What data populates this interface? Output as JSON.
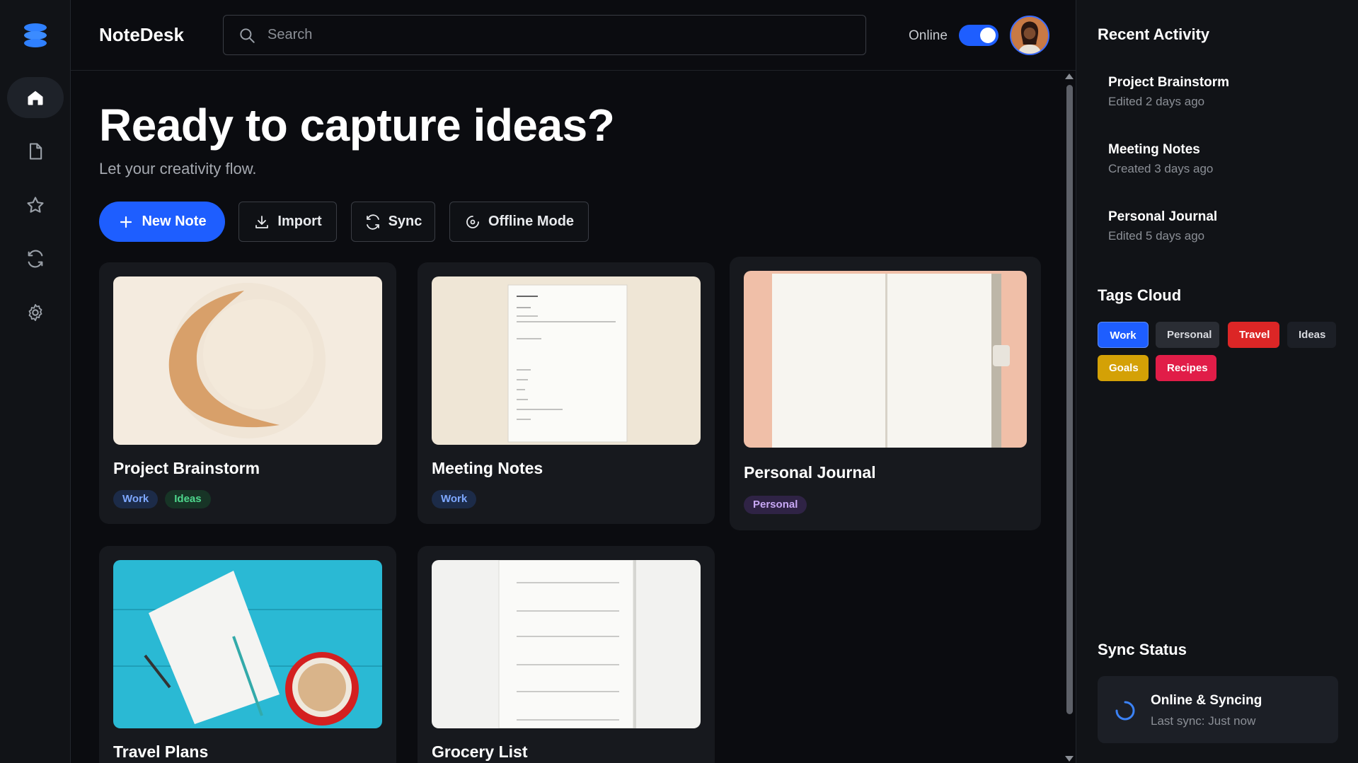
{
  "app": {
    "name": "NoteDesk"
  },
  "header": {
    "search_placeholder": "Search",
    "status_label": "Online",
    "online_toggle": true
  },
  "sidebar": {
    "items": [
      {
        "id": "home",
        "icon": "home-icon",
        "active": true
      },
      {
        "id": "notes",
        "icon": "file-icon",
        "active": false
      },
      {
        "id": "favorites",
        "icon": "star-icon",
        "active": false
      },
      {
        "id": "sync",
        "icon": "sync-icon",
        "active": false
      },
      {
        "id": "settings",
        "icon": "gear-icon",
        "active": false
      }
    ]
  },
  "hero": {
    "title": "Ready to capture ideas?",
    "subtitle": "Let your creativity flow."
  },
  "actions": {
    "new_note": "New Note",
    "import": "Import",
    "sync": "Sync",
    "offline": "Offline Mode"
  },
  "notes": [
    {
      "title": "Project Brainstorm",
      "tags": [
        "Work",
        "Ideas"
      ]
    },
    {
      "title": "Meeting Notes",
      "tags": [
        "Work"
      ]
    },
    {
      "title": "Personal Journal",
      "tags": [
        "Personal"
      ]
    },
    {
      "title": "Travel Plans",
      "tags": []
    },
    {
      "title": "Grocery List",
      "tags": []
    }
  ],
  "recent_activity": {
    "heading": "Recent Activity",
    "items": [
      {
        "title": "Project Brainstorm",
        "meta": "Edited 2 days ago"
      },
      {
        "title": "Meeting Notes",
        "meta": "Created 3 days ago"
      },
      {
        "title": "Personal Journal",
        "meta": "Edited 5 days ago"
      }
    ]
  },
  "tags_cloud": {
    "heading": "Tags Cloud",
    "tags": [
      {
        "label": "Work",
        "color": "#1e5eff"
      },
      {
        "label": "Personal",
        "color": "#2a2d34"
      },
      {
        "label": "Travel",
        "color": "#dc2626"
      },
      {
        "label": "Ideas",
        "color": "#1c1f26"
      },
      {
        "label": "Goals",
        "color": "#d4a106"
      },
      {
        "label": "Recipes",
        "color": "#e11d48"
      }
    ]
  },
  "sync_status": {
    "heading": "Sync Status",
    "title": "Online & Syncing",
    "last_sync": "Last sync: Just now"
  },
  "colors": {
    "accent": "#1e5eff",
    "background": "#0b0c10",
    "panel": "#111317",
    "card": "#17191e"
  }
}
